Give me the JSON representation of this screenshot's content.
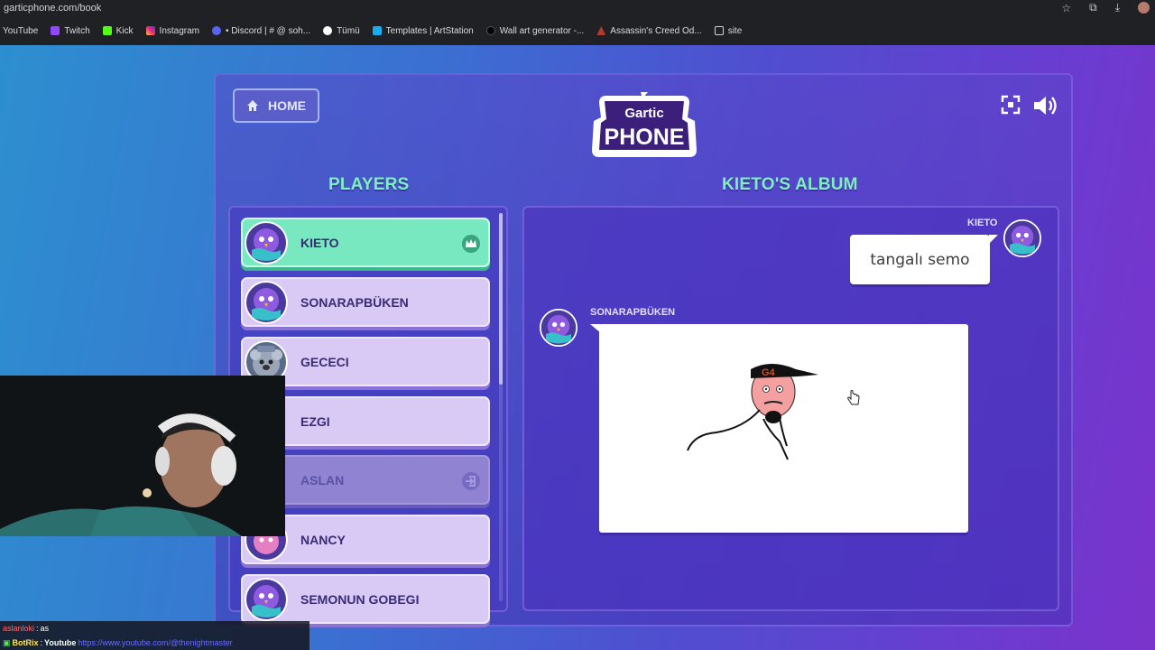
{
  "browser": {
    "url": "garticphone.com/book",
    "bookmarks": [
      {
        "label": "YouTube",
        "icon": "youtube-icon"
      },
      {
        "label": "Twitch",
        "icon": "twitch-icon"
      },
      {
        "label": "Kick",
        "icon": "kick-icon"
      },
      {
        "label": "Instagram",
        "icon": "instagram-icon"
      },
      {
        "label": "• Discord | # @ soh...",
        "icon": "discord-icon"
      },
      {
        "label": "Tümü",
        "icon": "google-icon"
      },
      {
        "label": "Templates | ArtStation",
        "icon": "artstation-icon"
      },
      {
        "label": "Wall art generator -...",
        "icon": "circle-icon"
      },
      {
        "label": "Assassin's Creed Od...",
        "icon": "assassins-creed-icon"
      },
      {
        "label": "site",
        "icon": "folder-icon"
      }
    ]
  },
  "game": {
    "home_label": "HOME",
    "logo_top": "Gartic",
    "logo_bottom": "PHONE",
    "players_title": "PLAYERS",
    "album_title": "KIETO'S ALBUM",
    "players": [
      {
        "name": "KIETO",
        "state": "active",
        "badge": "crown-icon"
      },
      {
        "name": "SONARAPBÜKEN",
        "state": "normal"
      },
      {
        "name": "GECECI",
        "state": "normal"
      },
      {
        "name": "EZGI",
        "state": "normal"
      },
      {
        "name": "ASLAN",
        "state": "faded",
        "badge": "exit-icon"
      },
      {
        "name": "NANCY",
        "state": "normal"
      },
      {
        "name": "SEMONUN GOBEGI",
        "state": "normal"
      }
    ],
    "album": {
      "message1_author": "KIETO",
      "message1_text": "tangalı semo",
      "message2_author": "SONARAPBÜKEN",
      "drawing_cap_text": "G4"
    }
  },
  "chat": {
    "line1_user": "aslanloki",
    "line1_sep": ":",
    "line1_text": "as",
    "line2_user": "BotRix",
    "line2_sep": ":",
    "line2_text": "Youtube",
    "line2_link": "https://www.youtube.com/@thenightmaster"
  },
  "colors": {
    "accent_green": "#7ef0c0",
    "player_card": "#d8c9f5",
    "active_card": "#77e8bf"
  }
}
